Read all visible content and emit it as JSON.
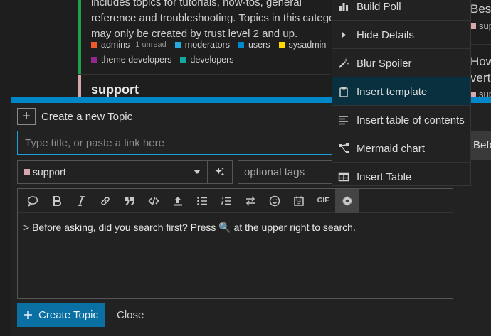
{
  "category": {
    "description": "includes topics for tutorials, how-tos, general reference and troubleshooting. Topics in this category may only be created by trust level 2 and up.",
    "subcategories_row1": [
      {
        "name": "admins",
        "color": "#f1592a",
        "unread": "1 unread"
      },
      {
        "name": "moderators",
        "color": "#25aae1"
      },
      {
        "name": "users",
        "color": "#0088cc"
      },
      {
        "name": "sysadmin",
        "color": "#fdd700"
      }
    ],
    "subcategories_row2": [
      {
        "name": "theme developers",
        "color": "#92278f"
      },
      {
        "name": "developers",
        "color": "#12a89d"
      }
    ],
    "next_category": "support"
  },
  "right_fragments": {
    "line1": "Bes",
    "line1_sub": "sup",
    "line2": "How",
    "line3": "verti",
    "line3_sub": "sup",
    "button": "Befo"
  },
  "composer": {
    "action_label": "Create a new Topic",
    "title_placeholder": "Type title, or paste a link here",
    "category_value": "support",
    "category_color": "#d4a8ad",
    "tags_placeholder": "optional tags",
    "editor_text": "> Before asking, did you search first? Press 🔍 at the upper right to search.",
    "toolbar": [
      {
        "icon": "speech-bubble-icon",
        "tip": "quote"
      },
      {
        "icon": "bold-icon",
        "tip": "bold"
      },
      {
        "icon": "italic-icon",
        "tip": "italic"
      },
      {
        "icon": "link-icon",
        "tip": "link"
      },
      {
        "icon": "quote-icon",
        "tip": "blockquote"
      },
      {
        "icon": "code-icon",
        "tip": "code"
      },
      {
        "icon": "upload-icon",
        "tip": "upload"
      },
      {
        "icon": "bullet-list-icon",
        "tip": "bullet list"
      },
      {
        "icon": "numbered-list-icon",
        "tip": "numbered list"
      },
      {
        "icon": "rtl-icon",
        "tip": "text direction"
      },
      {
        "icon": "emoji-icon",
        "tip": "emoji"
      },
      {
        "icon": "calendar-icon",
        "tip": "date"
      },
      {
        "icon": "gif-icon",
        "label": "GIF"
      },
      {
        "icon": "gear-icon",
        "tip": "options"
      }
    ],
    "create_label": "Create Topic",
    "close_label": "Close"
  },
  "menu": {
    "items": [
      {
        "label": "Build Poll",
        "icon": "bar-chart-icon"
      },
      {
        "label": "Hide Details",
        "icon": "caret-right-icon"
      },
      {
        "label": "Blur Spoiler",
        "icon": "magic-icon"
      },
      {
        "label": "Insert template",
        "icon": "clipboard-icon",
        "active": true
      },
      {
        "label": "Insert table of contents",
        "icon": "align-left-icon"
      },
      {
        "label": "Mermaid chart",
        "icon": "diagram-icon"
      },
      {
        "label": "Insert Table",
        "icon": "table-icon"
      }
    ]
  },
  "colors": {
    "accent": "#0087c9",
    "create_button": "#0a6fa3",
    "active_menu": "#08303f",
    "category_border": "#1aa34a"
  }
}
